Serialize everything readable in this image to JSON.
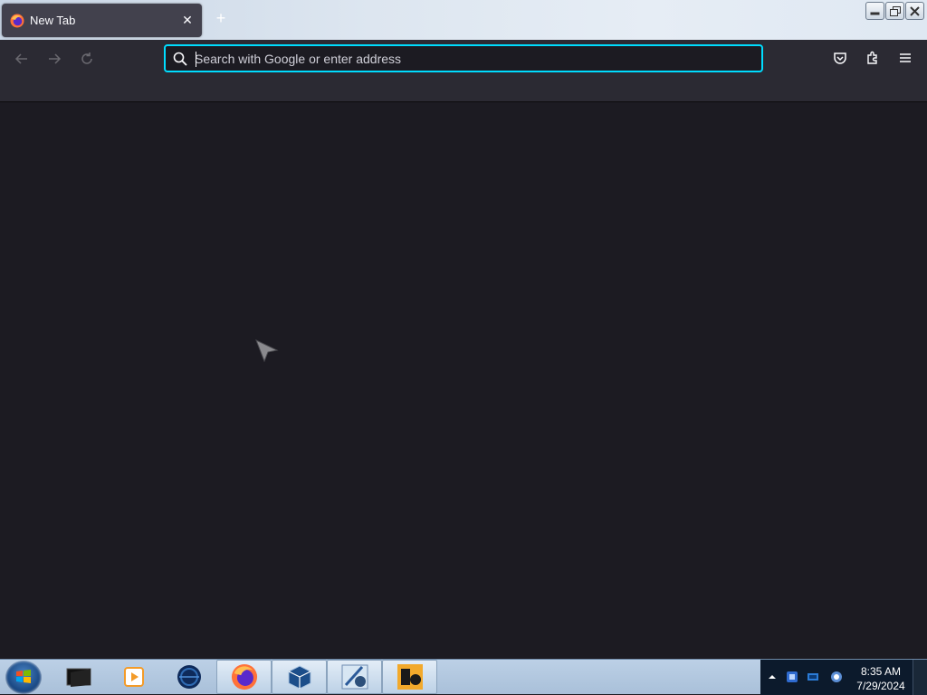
{
  "browser": {
    "tab": {
      "title": "New Tab",
      "close_glyph": "✕"
    },
    "new_tab_glyph": "+",
    "urlbar": {
      "placeholder": "Search with Google or enter address",
      "value": ""
    },
    "accent_color": "#00ddff"
  },
  "taskbar": {
    "apps": [
      {
        "name": "terminal-icon"
      },
      {
        "name": "media-player-icon"
      },
      {
        "name": "network-globe-icon"
      },
      {
        "name": "firefox-icon"
      },
      {
        "name": "virtualbox-icon"
      },
      {
        "name": "windows7-64-icon"
      },
      {
        "name": "de-app-icon"
      }
    ],
    "clock": {
      "time": "8:35 AM",
      "date": "7/29/2024"
    }
  }
}
